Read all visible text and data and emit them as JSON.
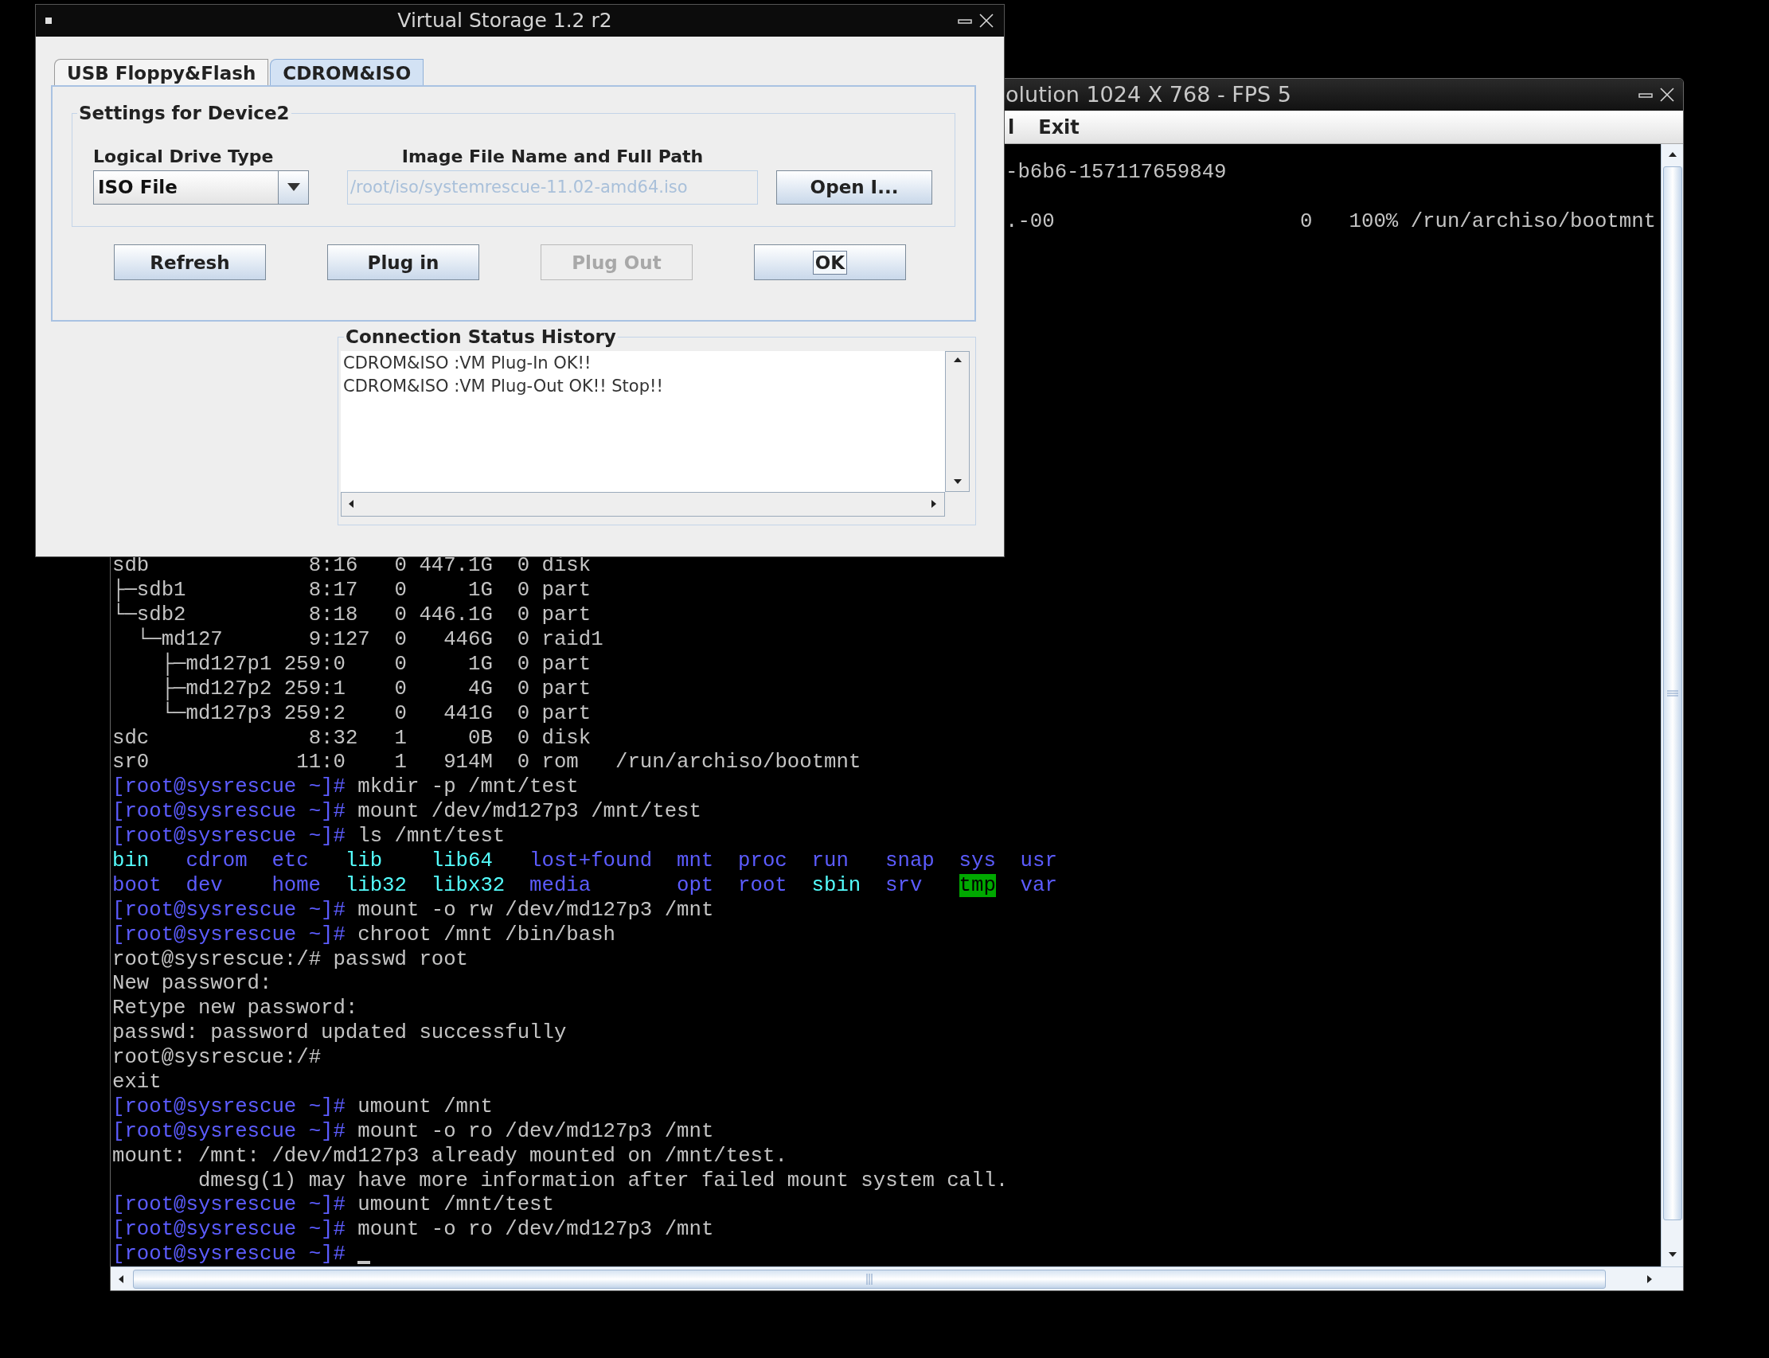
{
  "dialog": {
    "title": "Virtual Storage 1.2 r2",
    "tabs": [
      {
        "label": "USB Floppy&Flash",
        "selected": false
      },
      {
        "label": "CDROM&ISO",
        "selected": true
      }
    ],
    "group_title": "Settings for Device2",
    "drive_type": {
      "label": "Logical Drive Type",
      "value": "ISO File"
    },
    "image_path": {
      "label": "Image File Name and Full Path",
      "value": "/root/iso/systemrescue-11.02-amd64.iso",
      "disabled": true
    },
    "browse_button": {
      "label": "Open I..."
    },
    "buttons": [
      {
        "label": "Refresh",
        "disabled": false,
        "focused": false
      },
      {
        "label": "Plug in",
        "disabled": false,
        "focused": false
      },
      {
        "label": "Plug Out",
        "disabled": true,
        "focused": false
      },
      {
        "label": "OK",
        "disabled": false,
        "focused": true
      }
    ],
    "history": {
      "title": "Connection Status History",
      "lines": [
        "CDROM&ISO :VM Plug-In OK!!",
        "CDROM&ISO :VM Plug-Out OK!! Stop!!"
      ]
    }
  },
  "console": {
    "title": "olution 1024 X 768 - FPS 5",
    "menu": [
      "l",
      "Exit"
    ],
    "fragments": [
      "-b6b6-157117659849",
      ".-00                    0   100% /run/archiso/bootmnt"
    ],
    "lines": [
      {
        "kind": "plain",
        "text": "sdb             8:16   0 447.1G  0 disk"
      },
      {
        "kind": "plain",
        "text": "├─sdb1          8:17   0     1G  0 part"
      },
      {
        "kind": "plain",
        "text": "└─sdb2          8:18   0 446.1G  0 part"
      },
      {
        "kind": "plain",
        "text": "  └─md127       9:127  0   446G  0 raid1"
      },
      {
        "kind": "plain",
        "text": "    ├─md127p1 259:0    0     1G  0 part"
      },
      {
        "kind": "plain",
        "text": "    ├─md127p2 259:1    0     4G  0 part"
      },
      {
        "kind": "plain",
        "text": "    └─md127p3 259:2    0   441G  0 part"
      },
      {
        "kind": "plain",
        "text": "sdc             8:32   1     0B  0 disk"
      },
      {
        "kind": "plain",
        "text": "sr0            11:0    1   914M  0 rom   /run/archiso/bootmnt"
      },
      {
        "kind": "prompt",
        "prompt": "[root@sysrescue ~]#",
        "command": "mkdir -p /mnt/test"
      },
      {
        "kind": "prompt",
        "prompt": "[root@sysrescue ~]#",
        "command": "mount /dev/md127p3 /mnt/test"
      },
      {
        "kind": "prompt",
        "prompt": "[root@sysrescue ~]#",
        "command": "ls /mnt/test"
      },
      {
        "kind": "listing",
        "entries": [
          {
            "name": "bin",
            "kind": "link"
          },
          {
            "name": "cdrom",
            "kind": "dir"
          },
          {
            "name": "etc",
            "kind": "dir"
          },
          {
            "name": "lib",
            "kind": "link"
          },
          {
            "name": "lib64",
            "kind": "link"
          },
          {
            "name": "lost+found",
            "kind": "dir"
          },
          {
            "name": "mnt",
            "kind": "dir"
          },
          {
            "name": "proc",
            "kind": "dir"
          },
          {
            "name": "run",
            "kind": "dir"
          },
          {
            "name": "snap",
            "kind": "dir"
          },
          {
            "name": "sys",
            "kind": "dir"
          },
          {
            "name": "usr",
            "kind": "dir"
          }
        ]
      },
      {
        "kind": "listing",
        "entries": [
          {
            "name": "boot",
            "kind": "dir"
          },
          {
            "name": "dev",
            "kind": "dir"
          },
          {
            "name": "home",
            "kind": "dir"
          },
          {
            "name": "lib32",
            "kind": "link"
          },
          {
            "name": "libx32",
            "kind": "link"
          },
          {
            "name": "media",
            "kind": "dir"
          },
          {
            "name": "opt",
            "kind": "dir"
          },
          {
            "name": "root",
            "kind": "dir"
          },
          {
            "name": "sbin",
            "kind": "link"
          },
          {
            "name": "srv",
            "kind": "dir"
          },
          {
            "name": "tmp",
            "kind": "sticky"
          },
          {
            "name": "var",
            "kind": "dir"
          }
        ]
      },
      {
        "kind": "prompt",
        "prompt": "[root@sysrescue ~]#",
        "command": "mount -o rw /dev/md127p3 /mnt"
      },
      {
        "kind": "prompt",
        "prompt": "[root@sysrescue ~]#",
        "command": "chroot /mnt /bin/bash"
      },
      {
        "kind": "plain",
        "text": "root@sysrescue:/# passwd root"
      },
      {
        "kind": "plain",
        "text": "New password:"
      },
      {
        "kind": "plain",
        "text": "Retype new password:"
      },
      {
        "kind": "plain",
        "text": "passwd: password updated successfully"
      },
      {
        "kind": "plain",
        "text": "root@sysrescue:/#"
      },
      {
        "kind": "plain",
        "text": "exit"
      },
      {
        "kind": "prompt",
        "prompt": "[root@sysrescue ~]#",
        "command": "umount /mnt"
      },
      {
        "kind": "prompt",
        "prompt": "[root@sysrescue ~]#",
        "command": "mount -o ro /dev/md127p3 /mnt"
      },
      {
        "kind": "plain",
        "text": "mount: /mnt: /dev/md127p3 already mounted on /mnt/test."
      },
      {
        "kind": "indented",
        "text": "dmesg(1) may have more information after failed mount system call."
      },
      {
        "kind": "prompt",
        "prompt": "[root@sysrescue ~]#",
        "command": "umount /mnt/test"
      },
      {
        "kind": "prompt",
        "prompt": "[root@sysrescue ~]#",
        "command": "mount -o ro /dev/md127p3 /mnt"
      },
      {
        "kind": "prompt",
        "prompt": "[root@sysrescue ~]#",
        "cursor": true
      }
    ]
  }
}
